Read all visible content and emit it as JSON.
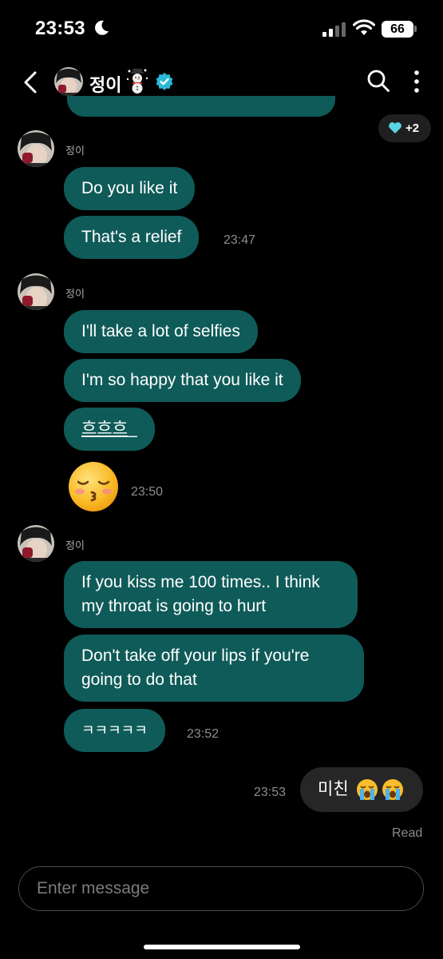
{
  "status_bar": {
    "time": "23:53",
    "battery": "66",
    "icons": [
      "moon-icon",
      "cellular-signal-icon",
      "wifi-icon",
      "battery-icon"
    ]
  },
  "header": {
    "name": "정이",
    "icons": [
      "back-icon",
      "snowman-icon",
      "verified-badge-icon",
      "search-icon",
      "more-icon"
    ],
    "verified_color": "#2bb8d6"
  },
  "reaction": {
    "icon": "heart-icon",
    "count": "+2",
    "heart_color": "#5ad2e0"
  },
  "colors": {
    "incoming_bubble": "#0f5b59",
    "outgoing_bubble": "#262626",
    "background": "#000000"
  },
  "groups": [
    {
      "sender": "정이",
      "messages": [
        {
          "text": "Do you like it"
        },
        {
          "text": "That's a relief",
          "time": "23:47"
        }
      ]
    },
    {
      "sender": "정이",
      "messages": [
        {
          "text": "I'll take a lot of selfies"
        },
        {
          "text": "I'm so happy that you like it"
        },
        {
          "text": "흐흐흐"
        },
        {
          "emoji": "kissing-face-closed-eyes",
          "time": "23:50"
        }
      ]
    },
    {
      "sender": "정이",
      "messages": [
        {
          "text": "If you kiss me 100 times.. I think my throat is going to hurt"
        },
        {
          "text": "Don't take off your lips if you're going to do that"
        },
        {
          "text": "ㅋㅋㅋㅋㅋ",
          "time": "23:52"
        }
      ]
    }
  ],
  "outgoing": {
    "text": "미친",
    "emoji": [
      "loudly-crying-face",
      "loudly-crying-face"
    ],
    "time": "23:53",
    "read": "Read"
  },
  "input": {
    "placeholder": "Enter message"
  }
}
